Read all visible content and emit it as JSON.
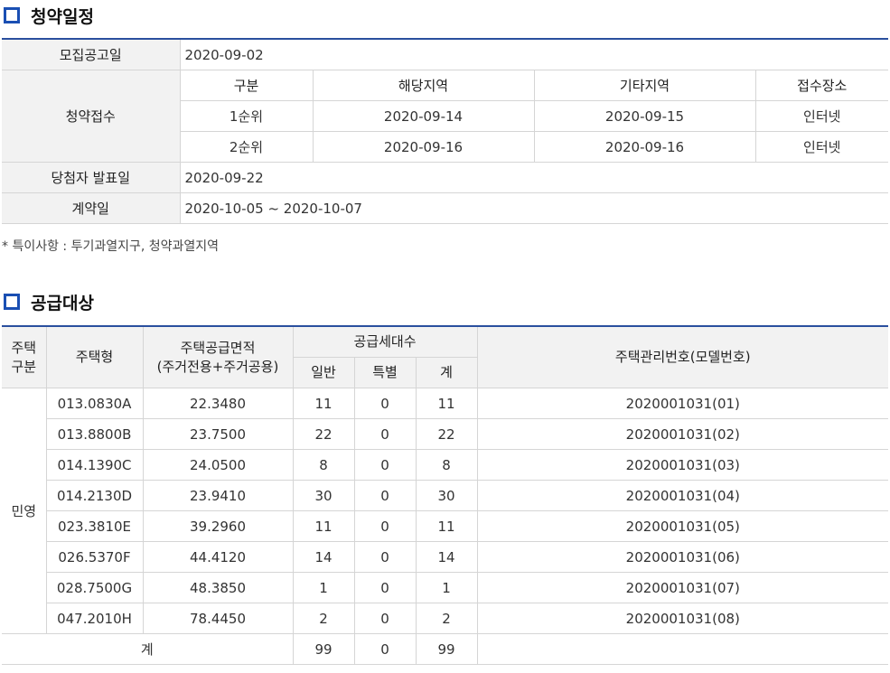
{
  "schedule": {
    "title": "청약일정",
    "announce_label": "모집공고일",
    "announce_date": "2020-09-02",
    "apply_label": "청약접수",
    "apply_headers": [
      "구분",
      "해당지역",
      "기타지역",
      "접수장소"
    ],
    "apply_rows": [
      [
        "1순위",
        "2020-09-14",
        "2020-09-15",
        "인터넷"
      ],
      [
        "2순위",
        "2020-09-16",
        "2020-09-16",
        "인터넷"
      ]
    ],
    "winner_label": "당첨자 발표일",
    "winner_date": "2020-09-22",
    "contract_label": "계약일",
    "contract_date": "2020-10-05 ~ 2020-10-07",
    "note": "* 특이사항 : 투기과열지구, 청약과열지역"
  },
  "supply": {
    "title": "공급대상",
    "headers": {
      "type_line1": "주택",
      "type_line2": "구분",
      "model": "주택형",
      "area_line1": "주택공급면적",
      "area_line2": "(주거전용+주거공용)",
      "units": "공급세대수",
      "general": "일반",
      "special": "특별",
      "total": "계",
      "mgmt": "주택관리번호(모델번호)"
    },
    "category": "민영",
    "rows": [
      [
        "013.0830A",
        "22.3480",
        "11",
        "0",
        "11",
        "2020001031(01)"
      ],
      [
        "013.8800B",
        "23.7500",
        "22",
        "0",
        "22",
        "2020001031(02)"
      ],
      [
        "014.1390C",
        "24.0500",
        "8",
        "0",
        "8",
        "2020001031(03)"
      ],
      [
        "014.2130D",
        "23.9410",
        "30",
        "0",
        "30",
        "2020001031(04)"
      ],
      [
        "023.3810E",
        "39.2960",
        "11",
        "0",
        "11",
        "2020001031(05)"
      ],
      [
        "026.5370F",
        "44.4120",
        "14",
        "0",
        "14",
        "2020001031(06)"
      ],
      [
        "028.7500G",
        "48.3850",
        "1",
        "0",
        "1",
        "2020001031(07)"
      ],
      [
        "047.2010H",
        "78.4450",
        "2",
        "0",
        "2",
        "2020001031(08)"
      ]
    ],
    "total_label": "계",
    "totals": [
      "99",
      "0",
      "99",
      ""
    ]
  },
  "colors": {
    "accent": "#1a4fb3",
    "header_bg": "#f2f2f2",
    "border": "#d5d5d5"
  }
}
